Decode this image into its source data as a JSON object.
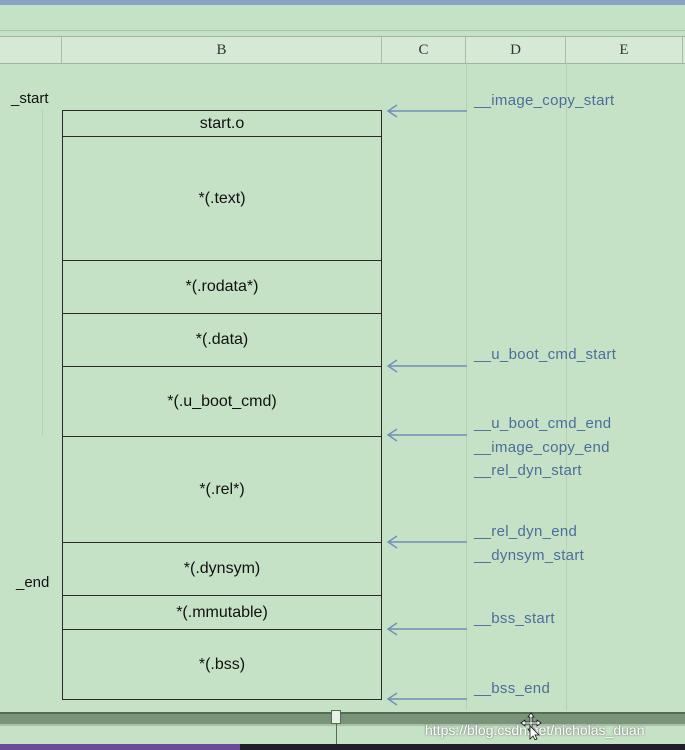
{
  "columns": [
    "B",
    "C",
    "D",
    "E"
  ],
  "left_symbols": {
    "start": "_start",
    "end": "_end"
  },
  "sections": [
    {
      "label": "start.o"
    },
    {
      "label": "*(.text)"
    },
    {
      "label": "*(.rodata*)"
    },
    {
      "label": "*(.data)"
    },
    {
      "label": "*(.u_boot_cmd)"
    },
    {
      "label": "*(.rel*)"
    },
    {
      "label": "*(.dynsym)"
    },
    {
      "label": "*(.mmutable)"
    },
    {
      "label": "*(.bss)"
    }
  ],
  "right_symbols": [
    "__image_copy_start",
    "__u_boot_cmd_start",
    "__u_boot_cmd_end",
    "__image_copy_end",
    "__rel_dyn_start",
    "__rel_dyn_end",
    "__dynsym_start",
    "__bss_start",
    "__bss_end"
  ],
  "watermark": "https://blog.csdn.net/nicholas_duan",
  "colors": {
    "background": "#c6e2c6",
    "symbol_text": "#4a6e9b",
    "arrow": "#6f8fb8"
  }
}
